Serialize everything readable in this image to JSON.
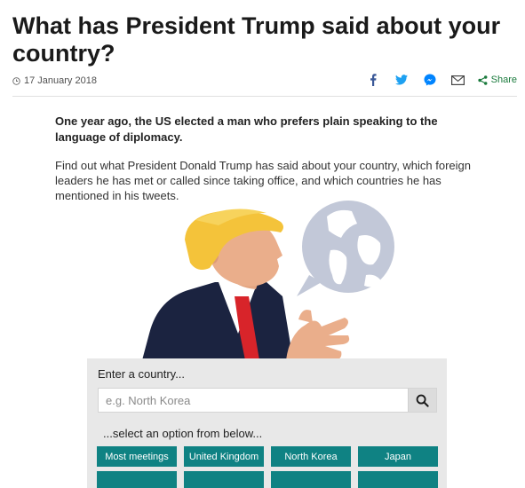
{
  "article": {
    "headline": "What has President Trump said about your country?",
    "date": "17 January 2018",
    "intro": "One year ago, the US elected a man who prefers plain speaking to the language of diplomacy.",
    "body": "Find out what President Donald Trump has said about your country, which foreign leaders he has met or called since taking office, and which countries he has mentioned in his tweets."
  },
  "share": {
    "label": "Share",
    "icons": [
      "facebook-icon",
      "twitter-icon",
      "messenger-icon",
      "email-icon",
      "share-icon"
    ],
    "colors": {
      "facebook": "#3b5998",
      "twitter": "#1da1f2",
      "messenger": "#0084ff",
      "email": "#444444",
      "share": "#1a7a3c"
    }
  },
  "country_search": {
    "label": "Enter a country...",
    "placeholder": "e.g. North Korea",
    "select_hint": "...select an option from below...",
    "options": [
      "Most meetings",
      "United Kingdom",
      "North Korea",
      "Japan"
    ],
    "button_color": "#0f8283"
  }
}
